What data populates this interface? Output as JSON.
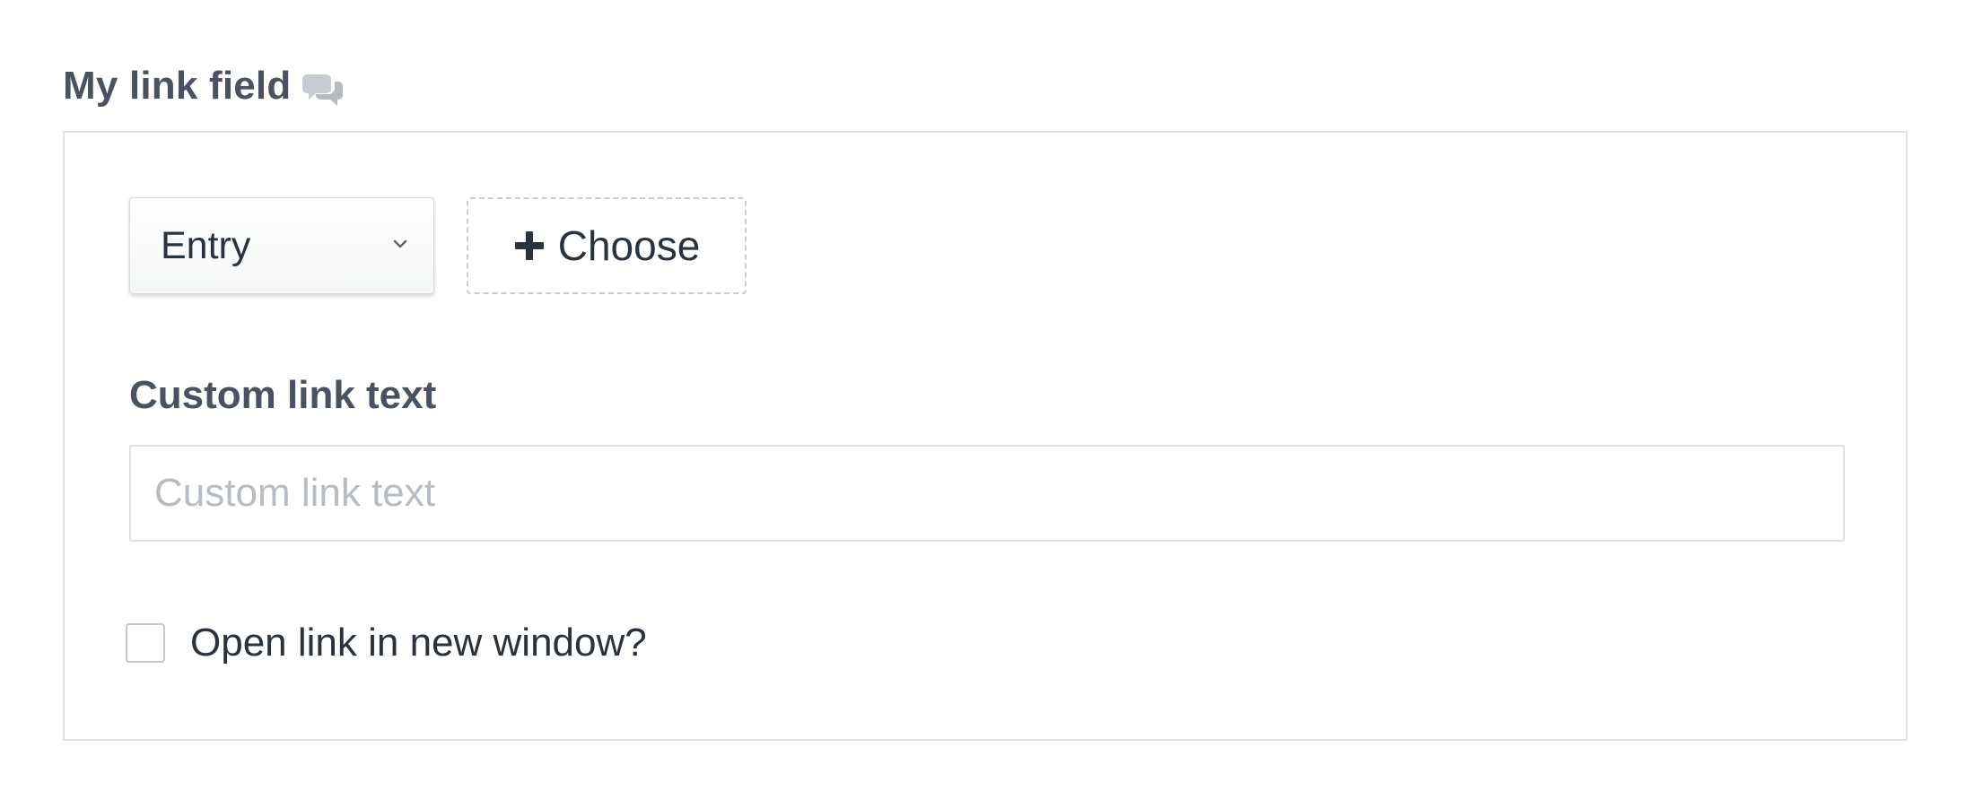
{
  "field": {
    "label": "My link field",
    "comment_icon": "speech-bubbles-icon"
  },
  "link_type_select": {
    "value": "Entry",
    "icon": "chevron-down-icon"
  },
  "choose_button": {
    "label": "Choose",
    "icon": "plus-icon"
  },
  "custom_link_text": {
    "label": "Custom link text",
    "placeholder": "Custom link text",
    "value": ""
  },
  "new_window_checkbox": {
    "label": "Open link in new window?",
    "checked": false
  },
  "colors": {
    "label_text": "#4a5161",
    "body_text": "#29323d",
    "border": "#dde1e6",
    "placeholder": "#b7bcc3"
  }
}
